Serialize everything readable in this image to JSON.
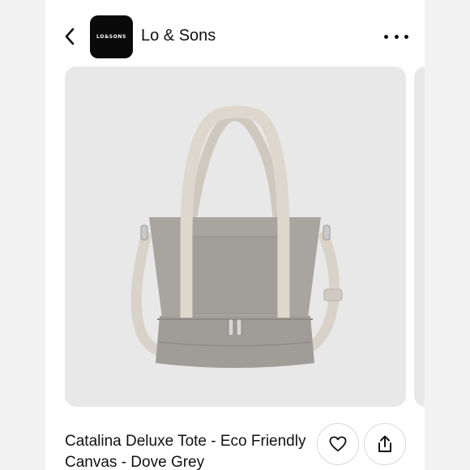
{
  "header": {
    "back_icon": "chevron-left-icon",
    "logo_text": "LO&SONS",
    "shop_name": "Lo & Sons",
    "more_icon": "more-horizontal-icon"
  },
  "product": {
    "image_alt": "Grey canvas tote bag with beige straps",
    "title": "Catalina Deluxe Tote - Eco Friendly Canvas - Dove Grey",
    "like_icon": "heart-icon",
    "share_icon": "share-icon"
  },
  "colors": {
    "background": "#ffffff",
    "image_bg": "#e8e8e8",
    "bag_body": "#a8a4a0",
    "strap": "#d8d2c8"
  }
}
